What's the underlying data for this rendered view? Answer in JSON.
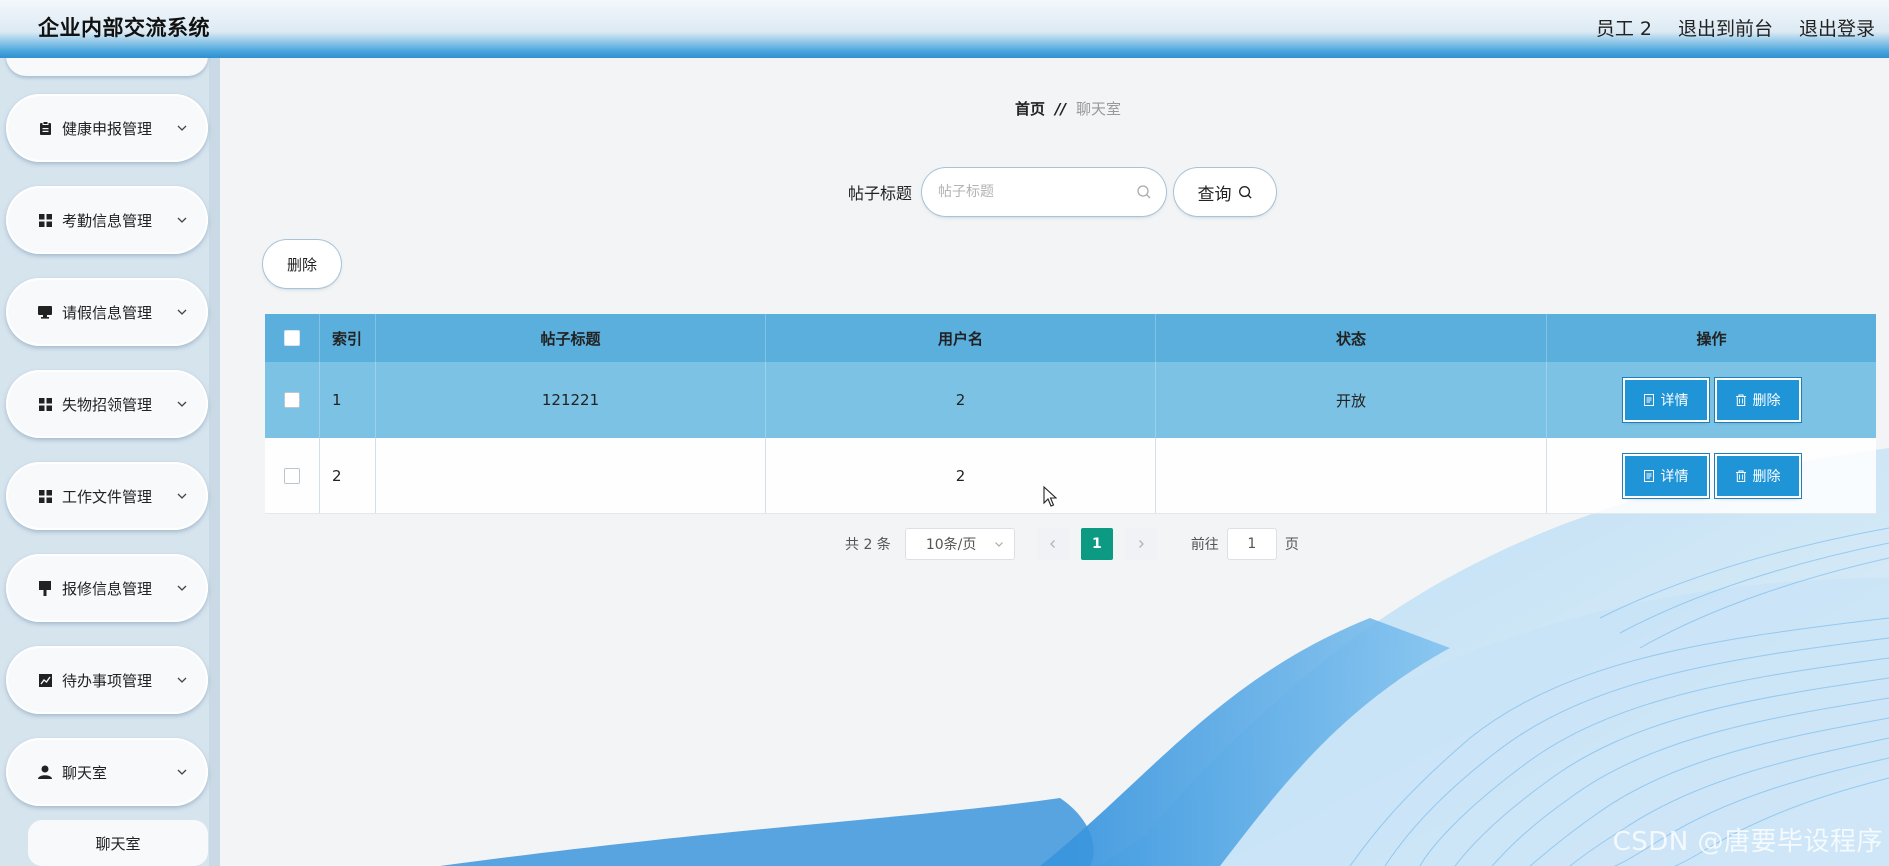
{
  "header": {
    "app_title": "企业内部交流系统",
    "user_label": "员工 2",
    "to_front_label": "退出到前台",
    "logout_label": "退出登录"
  },
  "sidebar": {
    "items": [
      {
        "label": "健康申报管理",
        "icon": "clipboard-icon"
      },
      {
        "label": "考勤信息管理",
        "icon": "grid-icon"
      },
      {
        "label": "请假信息管理",
        "icon": "monitor-icon"
      },
      {
        "label": "失物招领管理",
        "icon": "grid-icon"
      },
      {
        "label": "工作文件管理",
        "icon": "grid-icon"
      },
      {
        "label": "报修信息管理",
        "icon": "brush-icon"
      },
      {
        "label": "待办事项管理",
        "icon": "chart-icon"
      },
      {
        "label": "聊天室",
        "icon": "user-icon"
      }
    ],
    "sub_item": "聊天室"
  },
  "breadcrumb": {
    "home": "首页",
    "separator": "//",
    "current": "聊天室"
  },
  "search": {
    "label": "帖子标题",
    "placeholder": "帖子标题",
    "value": "",
    "button_label": "查询"
  },
  "toolbar": {
    "delete_label": "删除"
  },
  "table": {
    "columns": [
      "索引",
      "帖子标题",
      "用户名",
      "状态",
      "操作"
    ],
    "rows": [
      {
        "index": "1",
        "title": "121221",
        "username": "2",
        "status": "开放"
      },
      {
        "index": "2",
        "title": "",
        "username": "2",
        "status": ""
      }
    ],
    "detail_label": "详情",
    "delete_label": "删除"
  },
  "pagination": {
    "total": "共 2 条",
    "page_size": "10条/页",
    "current_page": "1",
    "goto_prefix": "前往",
    "goto_value": "1",
    "goto_suffix": "页"
  },
  "watermark": "CSDN @唐要毕设程序",
  "colors": {
    "accent": "#1f95d8",
    "table_header": "#5aafdc",
    "selected_row": "#7cc2e4",
    "active_page": "#0d9a83"
  }
}
